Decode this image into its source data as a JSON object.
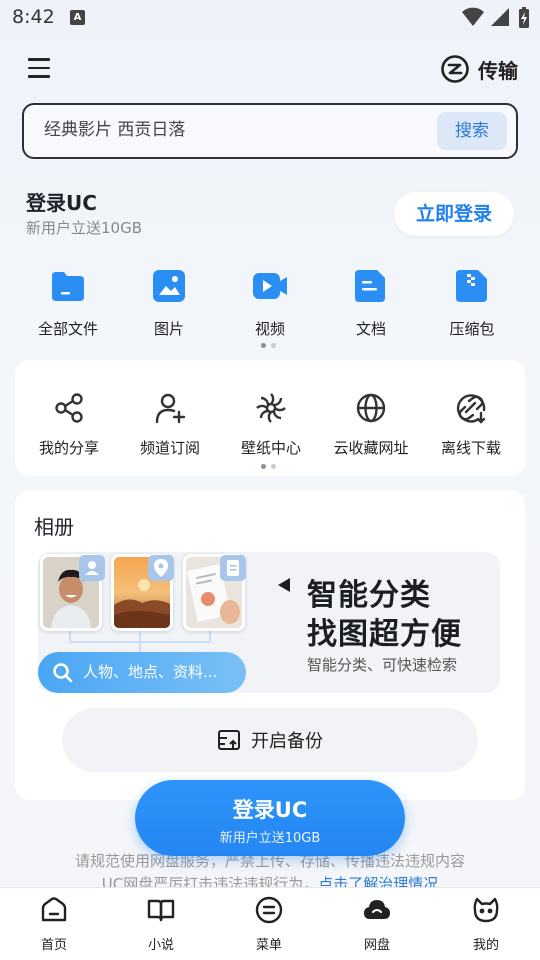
{
  "status_bar": {
    "time": "8:42"
  },
  "header": {
    "transfer_label": "传输"
  },
  "search": {
    "placeholder": "经典影片 西贡日落",
    "button": "搜索"
  },
  "login": {
    "title": "登录UC",
    "subtitle": "新用户立送10GB",
    "button": "立即登录"
  },
  "categories": [
    {
      "label": "全部文件",
      "icon": "folder-icon"
    },
    {
      "label": "图片",
      "icon": "image-icon"
    },
    {
      "label": "视频",
      "icon": "video-icon"
    },
    {
      "label": "文档",
      "icon": "document-icon"
    },
    {
      "label": "压缩包",
      "icon": "archive-icon"
    }
  ],
  "tools": [
    {
      "label": "我的分享",
      "icon": "share-icon"
    },
    {
      "label": "频道订阅",
      "icon": "subscribe-icon"
    },
    {
      "label": "壁纸中心",
      "icon": "wallpaper-icon"
    },
    {
      "label": "云收藏网址",
      "icon": "globe-icon"
    },
    {
      "label": "离线下载",
      "icon": "offline-download-icon"
    }
  ],
  "album": {
    "title": "相册",
    "search_pill": "人物、地点、资料...",
    "headline_1": "智能分类",
    "headline_2": "找图超方便",
    "description": "智能分类、可快速检索",
    "backup_button": "开启备份"
  },
  "floating_login": {
    "title": "登录UC",
    "subtitle": "新用户立送10GB"
  },
  "notice": {
    "line1": "请规范使用网盘服务，严禁上传、存储、传播违法违规内容",
    "line2_prefix": "UC网盘严厉打击违法违规行为，",
    "line2_link": "点击了解治理情况"
  },
  "tabs": [
    {
      "label": "首页",
      "icon": "home-icon"
    },
    {
      "label": "小说",
      "icon": "book-icon"
    },
    {
      "label": "菜单",
      "icon": "menu-circle-icon"
    },
    {
      "label": "网盘",
      "icon": "cloud-icon"
    },
    {
      "label": "我的",
      "icon": "profile-icon"
    }
  ],
  "colors": {
    "accent": "#1f7ff0",
    "category_icon": "#2b8ef5"
  }
}
